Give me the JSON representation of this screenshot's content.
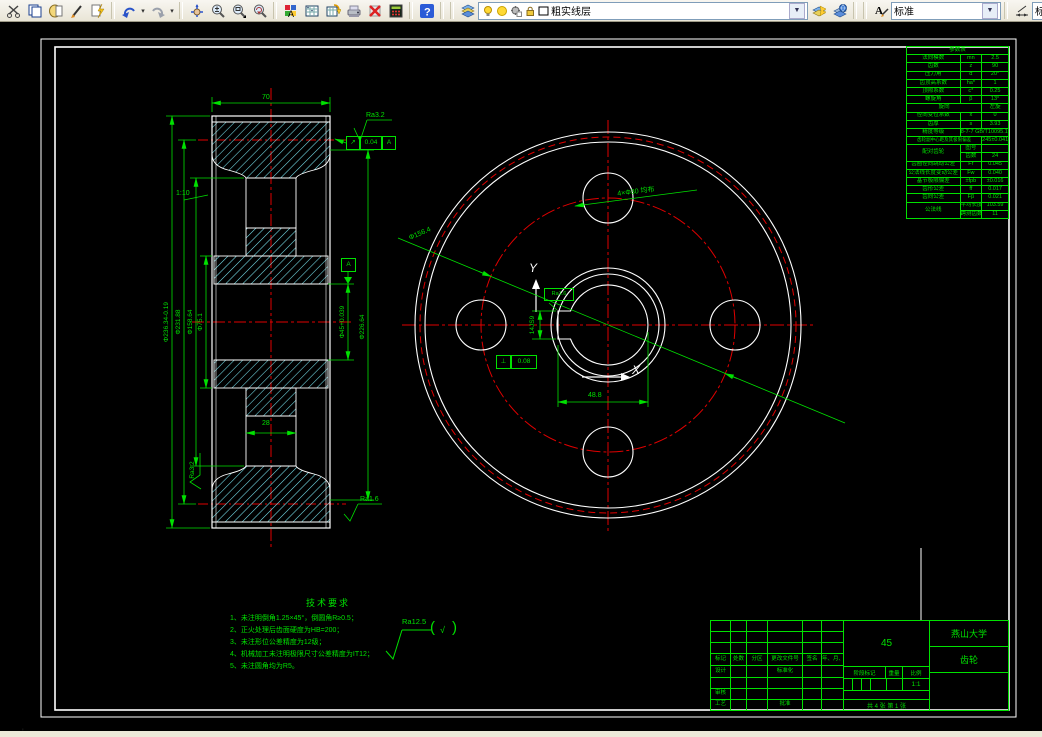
{
  "toolbar": {
    "layer_combo": "粗实线层",
    "text_style_combo": "标准",
    "dim_style_combo": "标准",
    "icons": [
      "cut",
      "copy",
      "paste",
      "pen",
      "format-painter",
      "undo",
      "redo",
      "pan",
      "zoom-in-out",
      "zoom-window",
      "zoom-previous",
      "style-manager",
      "library",
      "library-extract",
      "render",
      "delete",
      "calculator",
      "help",
      "layers",
      "layer-settings",
      "layer-tools",
      "text-style",
      "dim-style"
    ]
  },
  "dims": {
    "width": "70",
    "taper": "1:10",
    "ra_top": "Ra3.2",
    "gdt_sym": "↗",
    "gdt_val": "0.04",
    "gdt_datum": "A",
    "d_outer": "Φ236.34-0.19",
    "d_pitch": "Φ231.88",
    "d_mid": "Φ158.64",
    "d_hub": "Φ75.1",
    "d_bore": "Φ45+0.039",
    "datum": "A",
    "d_root": "Φ226.64",
    "web_width": "28",
    "ra_left": "Ra3.2",
    "ra_bottom": "Ra1.6",
    "key_ra": "Ra1.6",
    "key_width": "14JS9",
    "key_gdt_sym": "⊥",
    "key_gdt_val": "0.08",
    "key_depth": "48.8",
    "holes": "4×Φ30 均布",
    "bolt_circle": "Φ156.4",
    "axis_x": "X",
    "axis_y": "Y"
  },
  "tech_req": {
    "title": "技术要求",
    "lines": [
      "1、未注明倒角1.25×45°，倒圆角R≥0.5；",
      "2、正火处理后齿面硬度为HB=200；",
      "3、未注形位公差精度为12级；",
      "4、机械加工未注明极限尺寸公差精度为IT12；",
      "5、未注圆角均为R5。"
    ]
  },
  "roughness_note": {
    "value": "Ra12.5",
    "paren_open": "(",
    "check": "√",
    "paren_close": ")"
  },
  "param_table": {
    "title": "参数表",
    "rows1": [
      [
        "法向模数",
        "mn",
        "2.5"
      ],
      [
        "齿数",
        "z",
        "90"
      ],
      [
        "压力角",
        "α",
        "20°"
      ],
      [
        "齿顶高系数",
        "ha*",
        "1"
      ],
      [
        "顶隙系数",
        "c*",
        "0.25"
      ],
      [
        "螺旋角",
        "β",
        "13°"
      ],
      [
        "旋向",
        "",
        "左旋"
      ],
      [
        "径向变位系数",
        "x",
        "0"
      ],
      [
        "齿厚",
        "s",
        "3.93"
      ]
    ],
    "accuracy": {
      "label": "精度等级",
      "val": "8-7-7 GB/T10095.1"
    },
    "center_dist": {
      "label": "齿轮副中心距及其极限偏差",
      "val": "245±0.041"
    },
    "mate": {
      "label": "配对齿轮",
      "r1": [
        "图号",
        ""
      ],
      "r2": [
        "齿数",
        "24"
      ]
    },
    "tol_rows": [
      [
        "齿圈径向跳动公差",
        "Fr",
        "0.045"
      ],
      [
        "公法线长度变动公差",
        "Fw",
        "0.040"
      ],
      [
        "基节极限偏差",
        "±fpb",
        "±0.016"
      ],
      [
        "齿形公差",
        "ff",
        "0.017"
      ],
      [
        "齿向公差",
        "Fβ",
        "0.021"
      ]
    ],
    "wk": {
      "label": "公法线",
      "r1": [
        "平均长度 Wk",
        "103.59"
      ],
      "r2": [
        "跨测齿数 k",
        "11"
      ]
    }
  },
  "title_block": {
    "material": "45",
    "school": "燕山大学",
    "part": "齿轮",
    "scale": "1:1",
    "sheet": "共 4 张  第 1 张",
    "col_headers": [
      "标记",
      "处数",
      "分区",
      "更改文件号",
      "签名",
      "年、月、日"
    ],
    "row_labels": {
      "design": "设计",
      "standard": "标准化",
      "audit": "审核",
      "process": "工艺",
      "approve": "批准"
    },
    "stage": "阶段标记",
    "weight": "重量",
    "scale_label": "比例"
  },
  "statusbar": {
    "mark": "'"
  }
}
